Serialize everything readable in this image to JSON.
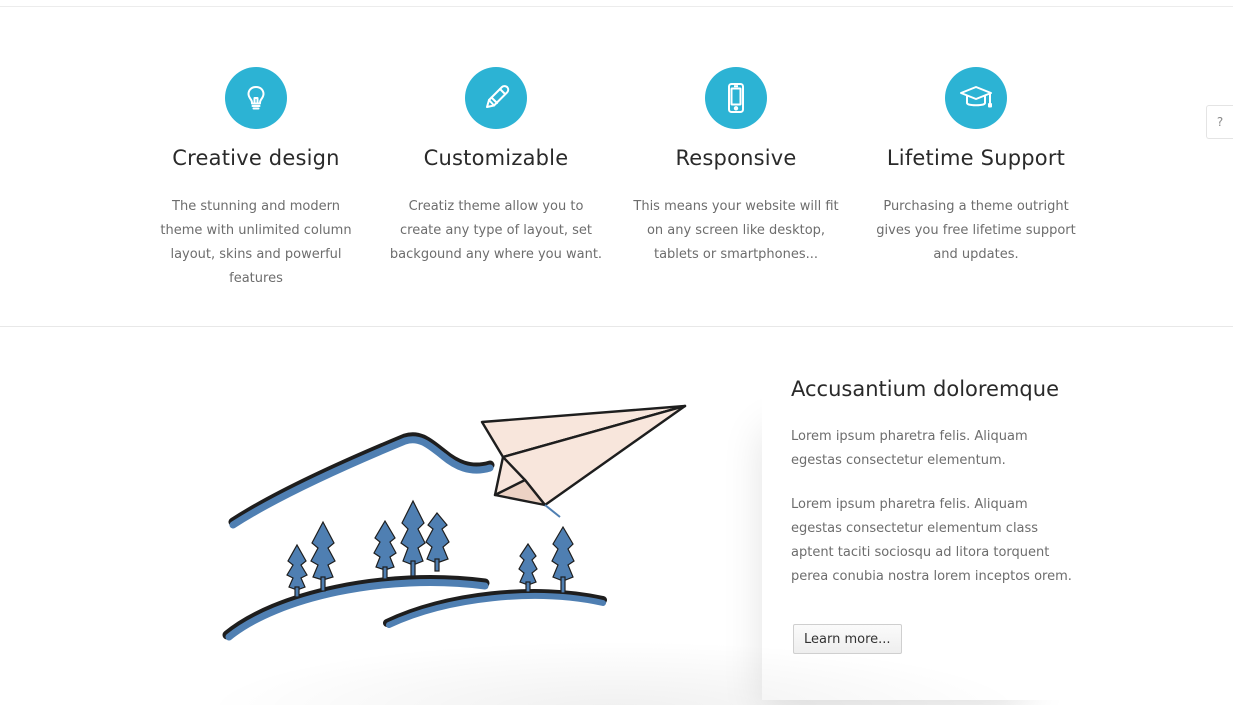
{
  "features": [
    {
      "icon": "lightbulb-icon",
      "title": "Creative design",
      "text": "The stunning and modern theme with unlimited column layout, skins and powerful features"
    },
    {
      "icon": "pencil-icon",
      "title": "Customizable",
      "text": "Creatiz theme allow you to create any type of layout, set backgound any where you want."
    },
    {
      "icon": "mobile-icon",
      "title": "Responsive",
      "text": "This means your website will fit on any screen like desktop, tablets or smartphones..."
    },
    {
      "icon": "graduation-cap-icon",
      "title": "Lifetime Support",
      "text": "Purchasing a theme outright gives you free lifetime support and updates."
    }
  ],
  "help_tab": {
    "label": "?"
  },
  "about": {
    "title": "Accusantium doloremque",
    "paragraph_1": "Lorem ipsum pharetra felis. Aliquam egestas consectetur elementum.",
    "paragraph_2": "Lorem ipsum pharetra felis. Aliquam egestas consectetur elementum class aptent taciti sociosqu ad litora torquent perea conubia nostra lorem inceptos orem.",
    "button_label": "Learn more..."
  },
  "colors": {
    "accent": "#2cb3d4",
    "illustration_blue": "#4f7fb2",
    "plane_fill": "#f8e6dc"
  }
}
